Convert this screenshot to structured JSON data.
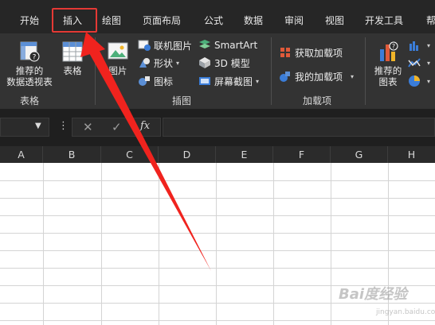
{
  "tabs": [
    {
      "label": "开始"
    },
    {
      "label": "插入"
    },
    {
      "label": "绘图"
    },
    {
      "label": "页面布局"
    },
    {
      "label": "公式"
    },
    {
      "label": "数据"
    },
    {
      "label": "审阅"
    },
    {
      "label": "视图"
    },
    {
      "label": "开发工具"
    },
    {
      "label": "帮"
    }
  ],
  "active_tab": "插入",
  "ribbon": {
    "tables_group": {
      "label": "表格",
      "recommended_pivot_line1": "推荐的",
      "recommended_pivot_line2": "数据透视表",
      "table": "表格"
    },
    "illustrations_group": {
      "label": "插图",
      "picture": "图片",
      "online_picture": "联机图片",
      "shapes": "形状",
      "icons": "图标",
      "smartart": "SmartArt",
      "models_3d": "3D 模型",
      "screenshot": "屏幕截图"
    },
    "addins_group": {
      "label": "加载项",
      "get_addins": "获取加载项",
      "my_addins": "我的加载项"
    },
    "charts_group": {
      "recommended_charts_line1": "推荐的",
      "recommended_charts_line2": "图表"
    }
  },
  "formula_bar": {
    "name_box_value": "",
    "fx_label": "fx",
    "formula_value": ""
  },
  "columns": [
    "A",
    "B",
    "C",
    "D",
    "E",
    "F",
    "G",
    "H"
  ],
  "watermark": {
    "text": "Bai度经验",
    "sub": "jingyan.baidu.com"
  },
  "colors": {
    "tabbar_bg": "#262626",
    "ribbon_bg": "#333333",
    "highlight": "#e53935",
    "arrow": "#f0231e"
  }
}
